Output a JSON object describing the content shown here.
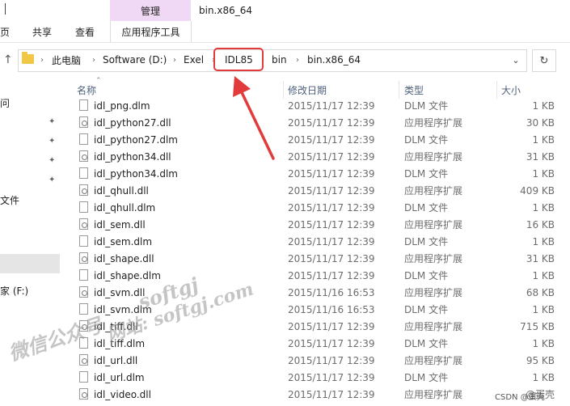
{
  "ribbon": {
    "manage_label": "管理",
    "window_title": "bin.x86_64",
    "tabs": [
      "页",
      "共享",
      "查看",
      "应用程序工具"
    ]
  },
  "address": {
    "crumbs": [
      "此电脑",
      "Software (D:)",
      "Exelis",
      "IDL85",
      "bin",
      "bin.x86_64"
    ],
    "separator": "›",
    "dropdown_glyph": "⌄",
    "refresh_glyph": "↻",
    "up_glyph": "↑"
  },
  "navpane": {
    "items": [
      "问",
      "文件",
      "家 (F:)"
    ]
  },
  "columns": {
    "name": "名称",
    "date": "修改日期",
    "type": "类型",
    "size": "大小"
  },
  "files": [
    {
      "name": "idl_png.dlm",
      "date": "2015/11/17 12:39",
      "type": "DLM 文件",
      "size": "1 KB",
      "kind": "dlm"
    },
    {
      "name": "idl_python27.dll",
      "date": "2015/11/17 12:39",
      "type": "应用程序扩展",
      "size": "30 KB",
      "kind": "dll"
    },
    {
      "name": "idl_python27.dlm",
      "date": "2015/11/17 12:39",
      "type": "DLM 文件",
      "size": "1 KB",
      "kind": "dlm"
    },
    {
      "name": "idl_python34.dll",
      "date": "2015/11/17 12:39",
      "type": "应用程序扩展",
      "size": "31 KB",
      "kind": "dll"
    },
    {
      "name": "idl_python34.dlm",
      "date": "2015/11/17 12:39",
      "type": "DLM 文件",
      "size": "1 KB",
      "kind": "dlm"
    },
    {
      "name": "idl_qhull.dll",
      "date": "2015/11/17 12:39",
      "type": "应用程序扩展",
      "size": "409 KB",
      "kind": "dll"
    },
    {
      "name": "idl_qhull.dlm",
      "date": "2015/11/17 12:39",
      "type": "DLM 文件",
      "size": "1 KB",
      "kind": "dlm"
    },
    {
      "name": "idl_sem.dll",
      "date": "2015/11/17 12:39",
      "type": "应用程序扩展",
      "size": "16 KB",
      "kind": "dll"
    },
    {
      "name": "idl_sem.dlm",
      "date": "2015/11/17 12:39",
      "type": "DLM 文件",
      "size": "1 KB",
      "kind": "dlm"
    },
    {
      "name": "idl_shape.dll",
      "date": "2015/11/17 12:39",
      "type": "应用程序扩展",
      "size": "31 KB",
      "kind": "dll"
    },
    {
      "name": "idl_shape.dlm",
      "date": "2015/11/17 12:39",
      "type": "DLM 文件",
      "size": "1 KB",
      "kind": "dlm"
    },
    {
      "name": "idl_svm.dll",
      "date": "2015/11/16 16:53",
      "type": "应用程序扩展",
      "size": "68 KB",
      "kind": "dll"
    },
    {
      "name": "idl_svm.dlm",
      "date": "2015/11/16 16:53",
      "type": "DLM 文件",
      "size": "1 KB",
      "kind": "dlm"
    },
    {
      "name": "idl_tiff.dll",
      "date": "2015/11/17 12:39",
      "type": "应用程序扩展",
      "size": "715 KB",
      "kind": "dll"
    },
    {
      "name": "idl_tiff.dlm",
      "date": "2015/11/17 12:39",
      "type": "DLM 文件",
      "size": "1 KB",
      "kind": "dlm"
    },
    {
      "name": "idl_url.dll",
      "date": "2015/11/17 12:39",
      "type": "应用程序扩展",
      "size": "95 KB",
      "kind": "dll"
    },
    {
      "name": "idl_url.dlm",
      "date": "2015/11/17 12:39",
      "type": "DLM 文件",
      "size": "1 KB",
      "kind": "dlm"
    },
    {
      "name": "idl_video.dll",
      "date": "2015/11/17 12:39",
      "type": "应用程序扩展",
      "size": "@蛋壳",
      "kind": "dll"
    }
  ],
  "watermarks": {
    "line1": "微信公众号",
    "line2": "softgj",
    "line3": "网站: softgj.com"
  },
  "credit": "CSDN @蛋壳"
}
